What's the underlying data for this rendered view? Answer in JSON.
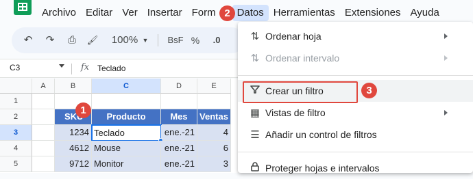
{
  "menubar": [
    "Archivo",
    "Editar",
    "Ver",
    "Insertar",
    "Formato",
    "Datos",
    "Herramientas",
    "Extensiones",
    "Ayuda"
  ],
  "menubar_visible": [
    "Archivo",
    "Editar",
    "Ver",
    "Insertar",
    "Form",
    "Datos",
    "Herramientas",
    "Extensiones",
    "Ayuda"
  ],
  "toolbar": {
    "undo": "↶",
    "redo": "↷",
    "print": "⎙",
    "paint": "🖌",
    "zoom": "100%",
    "format_currency": "BsF",
    "format_percent": "%",
    "decimal": ".0"
  },
  "formula_bar": {
    "cell_ref": "C3",
    "fx": "fx",
    "value": "Teclado"
  },
  "columns": [
    "A",
    "B",
    "C",
    "D",
    "E"
  ],
  "rows": [
    "1",
    "2",
    "3",
    "4",
    "5"
  ],
  "table": {
    "headers": [
      "SKU",
      "Producto",
      "Mes",
      "Ventas"
    ],
    "rows": [
      [
        "1234",
        "Teclado",
        "ene.-21",
        "4"
      ],
      [
        "4612",
        "Mouse",
        "ene.-21",
        "6"
      ],
      [
        "9712",
        "Monitor",
        "ene.-21",
        "3"
      ]
    ]
  },
  "data_menu": {
    "items": [
      {
        "label": "Ordenar hoja",
        "icon": "sort-icon",
        "enabled": true,
        "submenu": true
      },
      {
        "label": "Ordenar intervalo",
        "icon": "sort-icon",
        "enabled": false,
        "submenu": true
      },
      {
        "label": "Crear un filtro",
        "icon": "filter-icon",
        "enabled": true,
        "submenu": false
      },
      {
        "label": "Vistas de filtro",
        "icon": "filter-views-icon",
        "enabled": true,
        "submenu": true
      },
      {
        "label": "Añadir un control de filtros",
        "icon": "slicer-icon",
        "enabled": true,
        "submenu": false
      },
      {
        "label": "Proteger hojas e intervalos",
        "icon": "lock-icon",
        "enabled": true,
        "submenu": false
      }
    ]
  },
  "callouts": [
    "1",
    "2",
    "3"
  ],
  "colors": {
    "header_blue": "#4472c4",
    "data_blue": "#d9e1f2",
    "callout_red": "#e0473d",
    "selection": "#1a73e8"
  }
}
